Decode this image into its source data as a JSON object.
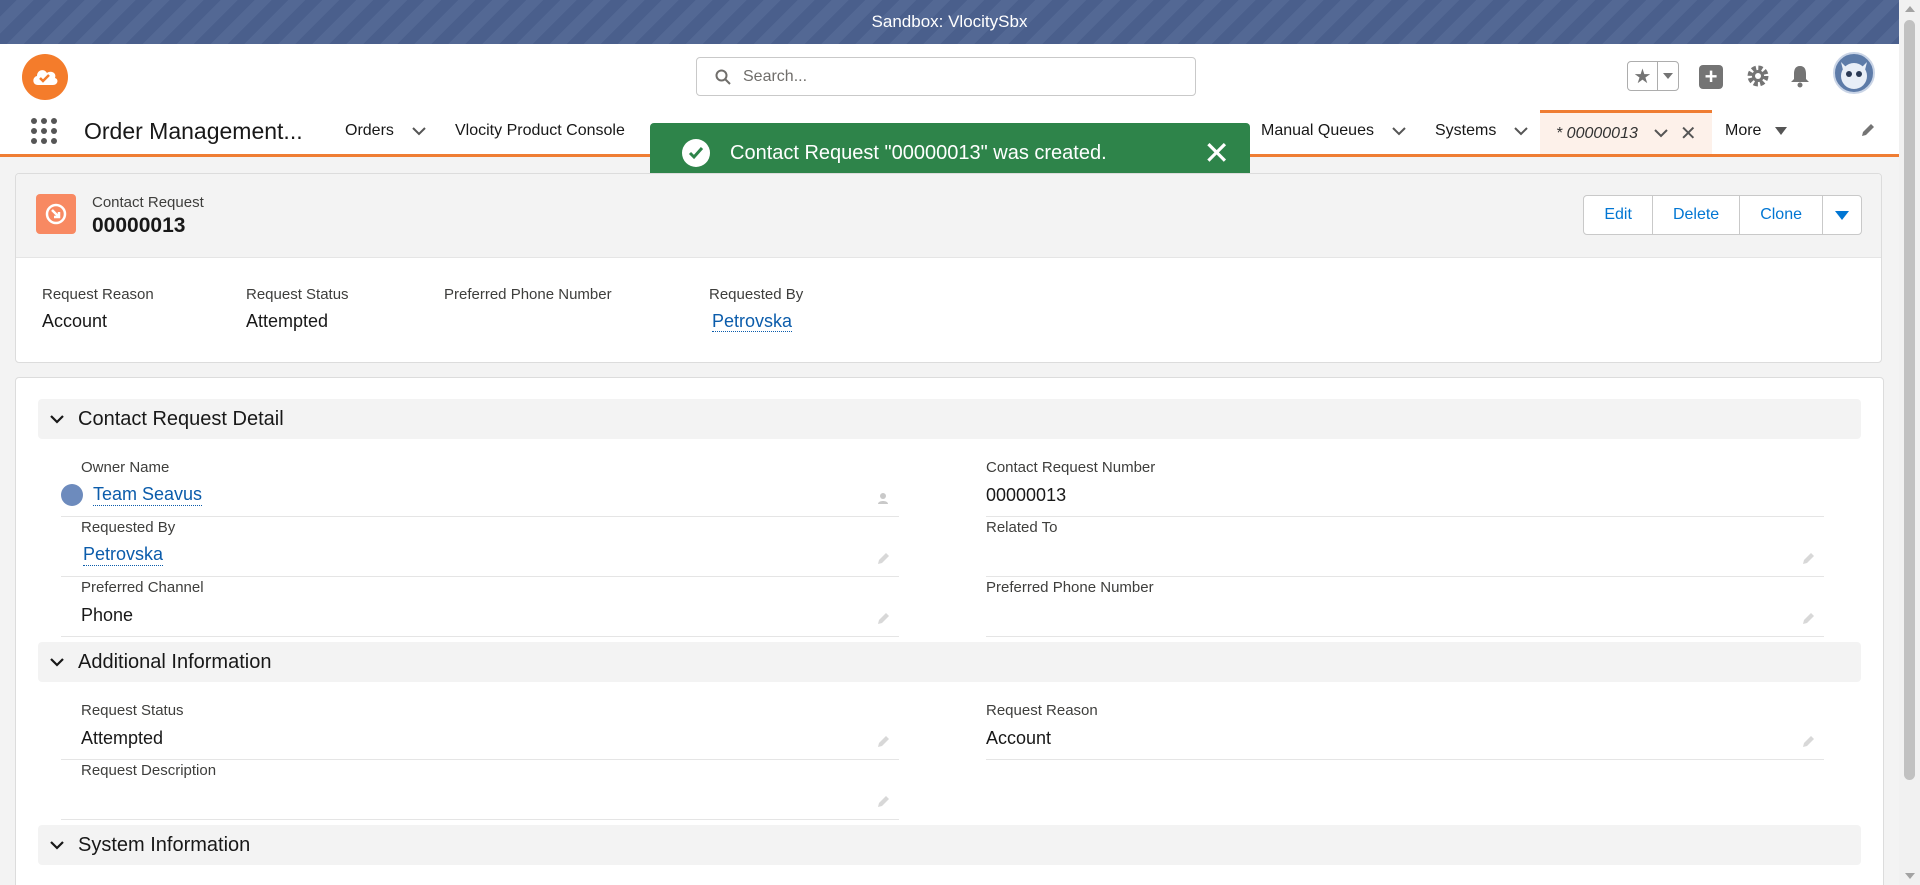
{
  "sandbox": {
    "label": "Sandbox: VlocitySbx"
  },
  "header": {
    "search_placeholder": "Search..."
  },
  "nav": {
    "app_name": "Order Management...",
    "items": [
      {
        "label": "Orders"
      },
      {
        "label": "Vlocity Product Console"
      },
      {
        "label": "Manual Queues"
      },
      {
        "label": "Systems"
      }
    ],
    "active_tab": "* 00000013",
    "more": "More"
  },
  "toast": {
    "message": "Contact Request \"00000013\" was created."
  },
  "record": {
    "type": "Contact Request",
    "title": "00000013",
    "actions": {
      "edit": "Edit",
      "delete": "Delete",
      "clone": "Clone"
    },
    "highlights": [
      {
        "label": "Request Reason",
        "value": "Account"
      },
      {
        "label": "Request Status",
        "value": "Attempted"
      },
      {
        "label": "Preferred Phone Number",
        "value": ""
      },
      {
        "label": "Requested By",
        "value": "Petrovska"
      }
    ]
  },
  "sections": {
    "detail": {
      "title": "Contact Request Detail",
      "owner_label": "Owner Name",
      "owner_value": "Team Seavus",
      "number_label": "Contact Request Number",
      "number_value": "00000013",
      "requested_by_label": "Requested By",
      "requested_by_value": "Petrovska",
      "related_to_label": "Related To",
      "related_to_value": "",
      "channel_label": "Preferred Channel",
      "channel_value": "Phone",
      "phone_label": "Preferred Phone Number",
      "phone_value": ""
    },
    "additional": {
      "title": "Additional Information",
      "status_label": "Request Status",
      "status_value": "Attempted",
      "reason_label": "Request Reason",
      "reason_value": "Account",
      "description_label": "Request Description",
      "description_value": ""
    },
    "system": {
      "title": "System Information"
    }
  },
  "colors": {
    "brand": "#ef7d33",
    "toast_success": "#2e844a",
    "link": "#0b5cab",
    "button_text": "#0176d3"
  }
}
